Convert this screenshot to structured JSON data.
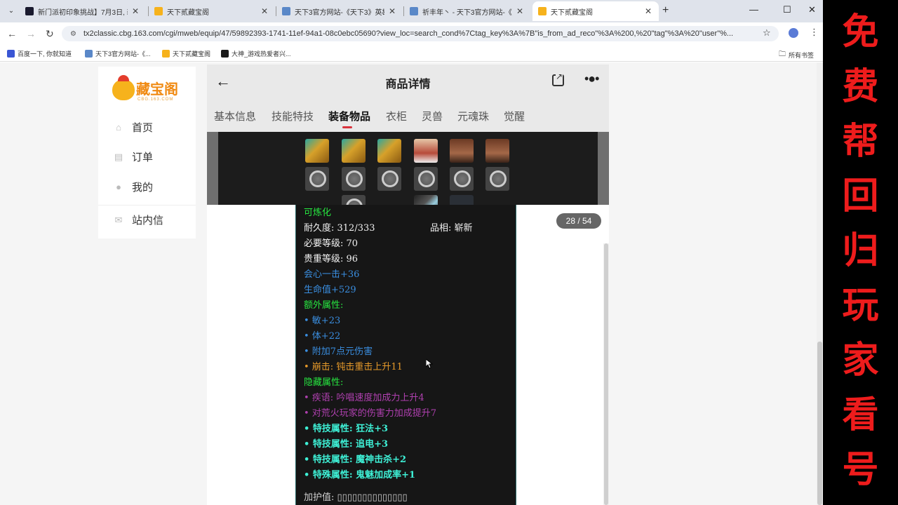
{
  "browser": {
    "tabs": [
      {
        "title": "新门派初印象挑战】7月3日, 新",
        "icon_color": "#1a1a2e"
      },
      {
        "title": "天下贰藏宝阁",
        "icon_color": "#f6b21c"
      },
      {
        "title": "天下3官方网站-《天下3》英雄",
        "icon_color": "#5a88c8"
      },
      {
        "title": "祈丰年丶 - 天下3官方网站-《天",
        "icon_color": "#5a88c8"
      },
      {
        "title": "天下贰藏宝阁",
        "icon_color": "#f6b21c",
        "active": true
      }
    ],
    "new_tab": "+",
    "window_controls": {
      "minimize": "—",
      "maximize": "☐",
      "close": "✕"
    },
    "nav": {
      "back": "←",
      "forward": "→",
      "reload": "↻"
    },
    "url": "tx2classic.cbg.163.com/cgi/mweb/equip/47/59892393-1741-11ef-94a1-08c0ebc05690?view_loc=search_cond%7Ctag_key%3A%7B\"is_from_ad_reco\"%3A%200,%20\"tag\"%3A%20\"user\"%...",
    "bookmarks": [
      {
        "label": "百度一下, 你就知道",
        "icon_color": "#3a56d4"
      },
      {
        "label": "天下3官方网站-《...",
        "icon_color": "#5a88c8"
      },
      {
        "label": "天下贰藏宝阁",
        "icon_color": "#f6b21c"
      },
      {
        "label": "大神_游戏热爱者兴...",
        "icon_color": "#1a1a1a"
      }
    ],
    "bookmarks_folder": "所有书签"
  },
  "sidebar": {
    "logo_text": "藏宝阁",
    "logo_sub": "CBG.163.COM",
    "items": [
      {
        "label": "首页",
        "icon": "home-icon"
      },
      {
        "label": "订单",
        "icon": "order-icon"
      },
      {
        "label": "我的",
        "icon": "user-icon"
      },
      {
        "label": "站内信",
        "icon": "mail-icon"
      }
    ]
  },
  "main": {
    "title": "商品详情",
    "tabs": [
      "基本信息",
      "技能特技",
      "装备物品",
      "衣柜",
      "灵兽",
      "元魂珠",
      "觉醒"
    ],
    "active_tab": "装备物品",
    "counter": "28 / 54"
  },
  "tooltip": {
    "lines": [
      {
        "text": "可炼化",
        "color": "green"
      },
      {
        "text": "耐久度: 312/333",
        "color": "white"
      },
      {
        "text": "品相: 崭新",
        "color": "white"
      },
      {
        "text": "必要等级: 70",
        "color": "white"
      },
      {
        "text": "贵重等级: 96",
        "color": "white"
      },
      {
        "text": "会心一击+36",
        "color": "blue"
      },
      {
        "text": "生命值+529",
        "color": "blue"
      },
      {
        "text": "额外属性:",
        "color": "green"
      },
      {
        "text": "• 敏+23",
        "color": "blue"
      },
      {
        "text": "• 体+22",
        "color": "blue"
      },
      {
        "text": "• 附加7点元伤害",
        "color": "blue"
      },
      {
        "text": "• 崩击: 钝击重击上升11",
        "color": "orange"
      },
      {
        "text": "隐藏属性:",
        "color": "green"
      },
      {
        "text": "• 疾语: 吟唱速度加成力上升4",
        "color": "purple"
      },
      {
        "text": "• 对荒火玩家的伤害力加成提升7",
        "color": "purple"
      },
      {
        "text": "• 特技属性: 狂法+3",
        "color": "cyan"
      },
      {
        "text": "• 特技属性: 追电+3",
        "color": "cyan"
      },
      {
        "text": "• 特技属性: 魔神击杀+2",
        "color": "cyan"
      },
      {
        "text": "• 特殊属性: 鬼魅加成率+1",
        "color": "cyan"
      },
      {
        "text": "加护值: ▯▯▯▯▯▯▯▯▯▯▯▯▯▯",
        "color": "gray"
      }
    ]
  },
  "banner": {
    "chars": [
      "免",
      "费",
      "帮",
      "回",
      "归",
      "玩",
      "家",
      "看",
      "号"
    ],
    "color": "#ee1c1c"
  }
}
